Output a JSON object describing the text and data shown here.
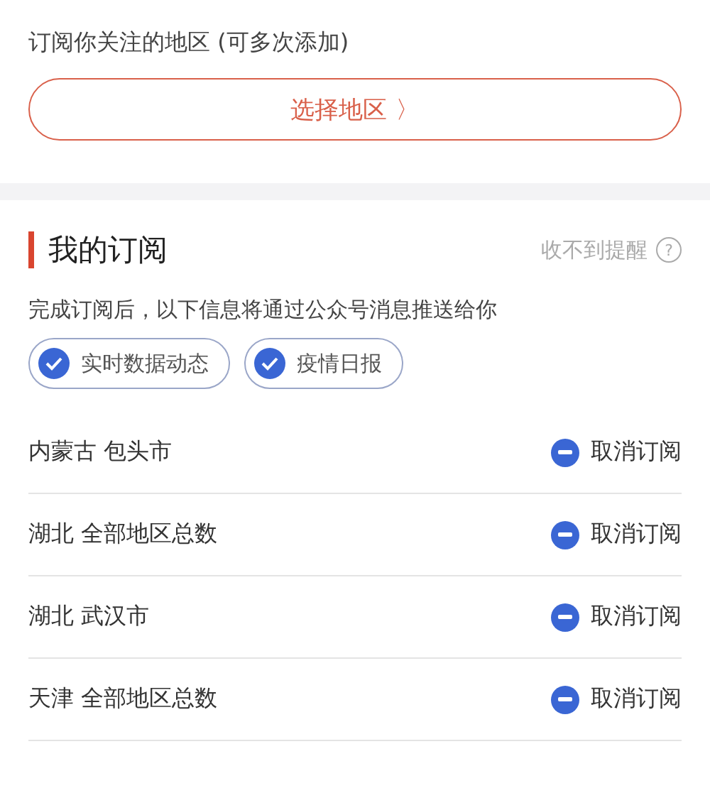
{
  "add_section": {
    "hint": "订阅你关注的地区 (可多次添加)",
    "button": "选择地区",
    "button_arrow": "〉"
  },
  "subscriptions": {
    "title": "我的订阅",
    "help_link": "收不到提醒",
    "help_icon": "?",
    "description": "完成订阅后，以下信息将通过公众号消息推送给你",
    "options": [
      {
        "label": "实时数据动态",
        "checked": true
      },
      {
        "label": "疫情日报",
        "checked": true
      }
    ],
    "items": [
      {
        "region": "内蒙古 包头市",
        "action": "取消订阅"
      },
      {
        "region": "湖北 全部地区总数",
        "action": "取消订阅"
      },
      {
        "region": "湖北 武汉市",
        "action": "取消订阅"
      },
      {
        "region": "天津 全部地区总数",
        "action": "取消订阅"
      }
    ]
  }
}
